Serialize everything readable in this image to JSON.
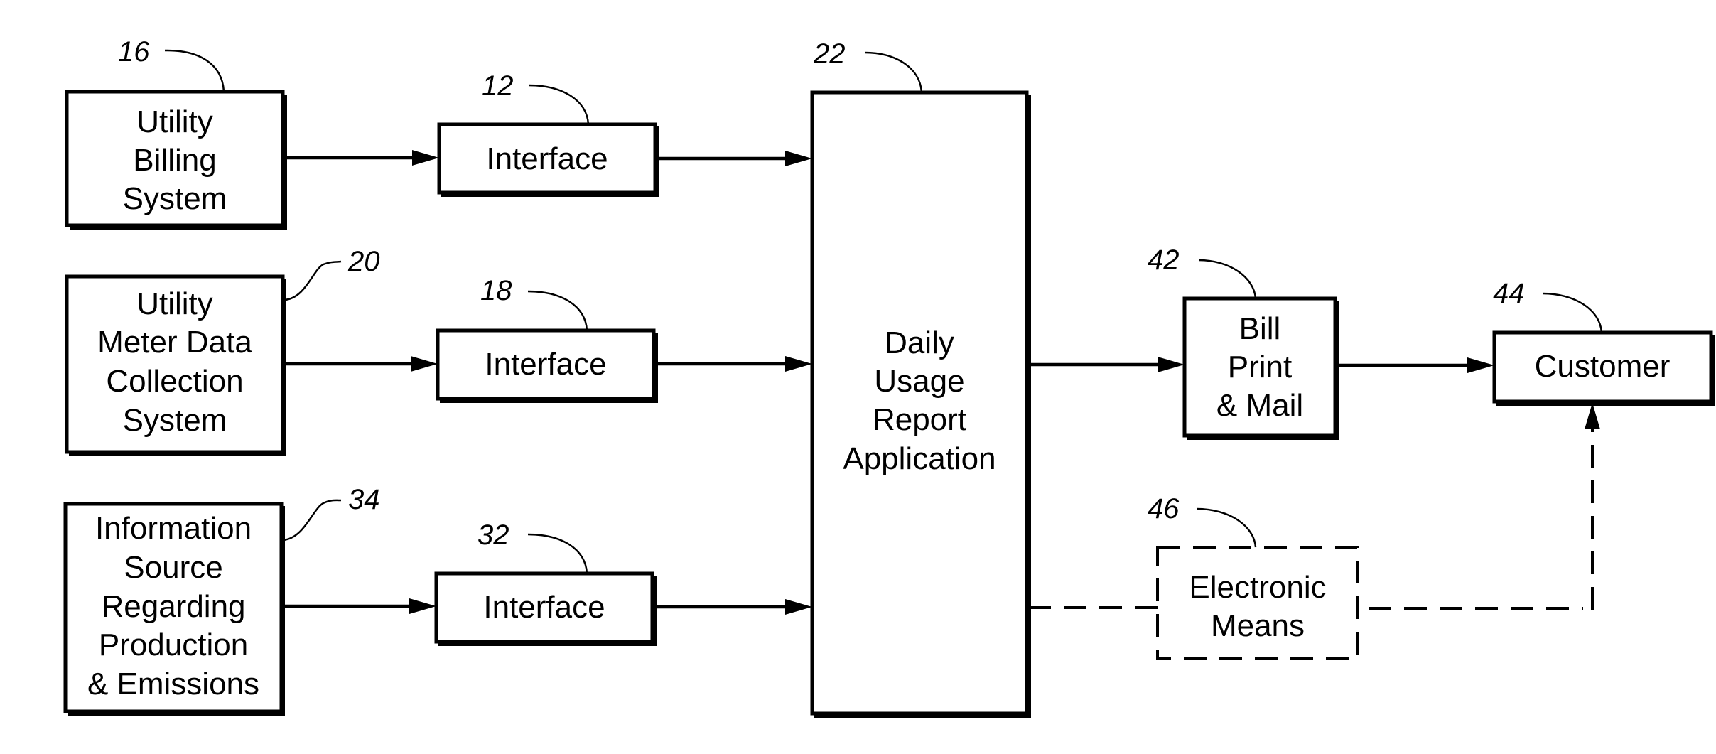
{
  "figure": {
    "blocks": [
      {
        "id": "utility-billing-system",
        "ref": "16",
        "lines": [
          "Utility",
          "Billing",
          "System"
        ],
        "style": "solid"
      },
      {
        "id": "interface-12",
        "ref": "12",
        "lines": [
          "Interface"
        ],
        "style": "solid"
      },
      {
        "id": "utility-meter-data-collection-system",
        "ref": "20",
        "lines": [
          "Utility",
          "Meter Data",
          "Collection",
          "System"
        ],
        "style": "solid"
      },
      {
        "id": "interface-18",
        "ref": "18",
        "lines": [
          "Interface"
        ],
        "style": "solid"
      },
      {
        "id": "information-source",
        "ref": "34",
        "lines": [
          "Information",
          "Source",
          "Regarding",
          "Production",
          "& Emissions"
        ],
        "style": "solid"
      },
      {
        "id": "interface-32",
        "ref": "32",
        "lines": [
          "Interface"
        ],
        "style": "solid"
      },
      {
        "id": "daily-usage-report-application",
        "ref": "22",
        "lines": [
          "Daily",
          "Usage",
          "Report",
          "Application"
        ],
        "style": "solid"
      },
      {
        "id": "bill-print-mail",
        "ref": "42",
        "lines": [
          "Bill",
          "Print",
          "& Mail"
        ],
        "style": "solid"
      },
      {
        "id": "customer",
        "ref": "44",
        "lines": [
          "Customer"
        ],
        "style": "solid"
      },
      {
        "id": "electronic-means",
        "ref": "46",
        "lines": [
          "Electronic",
          "Means"
        ],
        "style": "dashed"
      }
    ],
    "connections": [
      {
        "from": "utility-billing-system",
        "to": "interface-12",
        "style": "solid"
      },
      {
        "from": "interface-12",
        "to": "daily-usage-report-application",
        "style": "solid"
      },
      {
        "from": "utility-meter-data-collection-system",
        "to": "interface-18",
        "style": "solid"
      },
      {
        "from": "interface-18",
        "to": "daily-usage-report-application",
        "style": "solid"
      },
      {
        "from": "information-source",
        "to": "interface-32",
        "style": "solid"
      },
      {
        "from": "interface-32",
        "to": "daily-usage-report-application",
        "style": "solid"
      },
      {
        "from": "daily-usage-report-application",
        "to": "bill-print-mail",
        "style": "solid"
      },
      {
        "from": "bill-print-mail",
        "to": "customer",
        "style": "solid"
      },
      {
        "from": "daily-usage-report-application",
        "to": "customer",
        "via": "electronic-means",
        "style": "dashed"
      }
    ]
  }
}
